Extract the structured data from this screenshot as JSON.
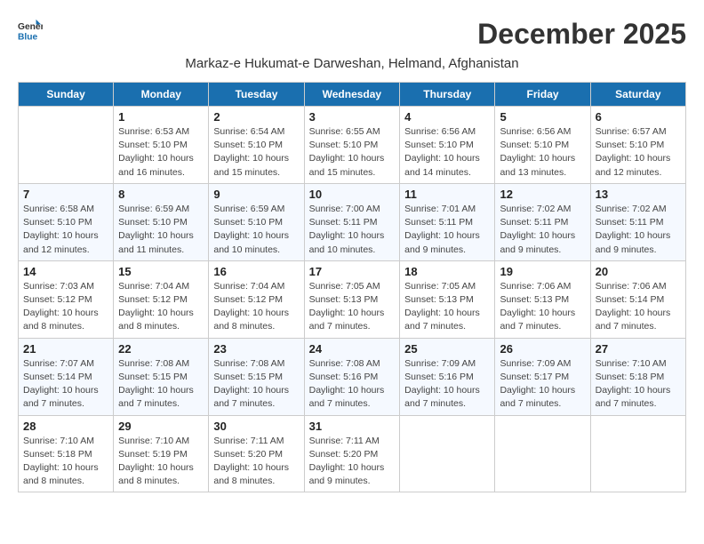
{
  "logo": {
    "line1": "General",
    "line2": "Blue"
  },
  "title": "December 2025",
  "subtitle": "Markaz-e Hukumat-e Darweshan, Helmand, Afghanistan",
  "weekdays": [
    "Sunday",
    "Monday",
    "Tuesday",
    "Wednesday",
    "Thursday",
    "Friday",
    "Saturday"
  ],
  "weeks": [
    [
      {
        "day": "",
        "info": ""
      },
      {
        "day": "1",
        "info": "Sunrise: 6:53 AM\nSunset: 5:10 PM\nDaylight: 10 hours\nand 16 minutes."
      },
      {
        "day": "2",
        "info": "Sunrise: 6:54 AM\nSunset: 5:10 PM\nDaylight: 10 hours\nand 15 minutes."
      },
      {
        "day": "3",
        "info": "Sunrise: 6:55 AM\nSunset: 5:10 PM\nDaylight: 10 hours\nand 15 minutes."
      },
      {
        "day": "4",
        "info": "Sunrise: 6:56 AM\nSunset: 5:10 PM\nDaylight: 10 hours\nand 14 minutes."
      },
      {
        "day": "5",
        "info": "Sunrise: 6:56 AM\nSunset: 5:10 PM\nDaylight: 10 hours\nand 13 minutes."
      },
      {
        "day": "6",
        "info": "Sunrise: 6:57 AM\nSunset: 5:10 PM\nDaylight: 10 hours\nand 12 minutes."
      }
    ],
    [
      {
        "day": "7",
        "info": "Sunrise: 6:58 AM\nSunset: 5:10 PM\nDaylight: 10 hours\nand 12 minutes."
      },
      {
        "day": "8",
        "info": "Sunrise: 6:59 AM\nSunset: 5:10 PM\nDaylight: 10 hours\nand 11 minutes."
      },
      {
        "day": "9",
        "info": "Sunrise: 6:59 AM\nSunset: 5:10 PM\nDaylight: 10 hours\nand 10 minutes."
      },
      {
        "day": "10",
        "info": "Sunrise: 7:00 AM\nSunset: 5:11 PM\nDaylight: 10 hours\nand 10 minutes."
      },
      {
        "day": "11",
        "info": "Sunrise: 7:01 AM\nSunset: 5:11 PM\nDaylight: 10 hours\nand 9 minutes."
      },
      {
        "day": "12",
        "info": "Sunrise: 7:02 AM\nSunset: 5:11 PM\nDaylight: 10 hours\nand 9 minutes."
      },
      {
        "day": "13",
        "info": "Sunrise: 7:02 AM\nSunset: 5:11 PM\nDaylight: 10 hours\nand 9 minutes."
      }
    ],
    [
      {
        "day": "14",
        "info": "Sunrise: 7:03 AM\nSunset: 5:12 PM\nDaylight: 10 hours\nand 8 minutes."
      },
      {
        "day": "15",
        "info": "Sunrise: 7:04 AM\nSunset: 5:12 PM\nDaylight: 10 hours\nand 8 minutes."
      },
      {
        "day": "16",
        "info": "Sunrise: 7:04 AM\nSunset: 5:12 PM\nDaylight: 10 hours\nand 8 minutes."
      },
      {
        "day": "17",
        "info": "Sunrise: 7:05 AM\nSunset: 5:13 PM\nDaylight: 10 hours\nand 7 minutes."
      },
      {
        "day": "18",
        "info": "Sunrise: 7:05 AM\nSunset: 5:13 PM\nDaylight: 10 hours\nand 7 minutes."
      },
      {
        "day": "19",
        "info": "Sunrise: 7:06 AM\nSunset: 5:13 PM\nDaylight: 10 hours\nand 7 minutes."
      },
      {
        "day": "20",
        "info": "Sunrise: 7:06 AM\nSunset: 5:14 PM\nDaylight: 10 hours\nand 7 minutes."
      }
    ],
    [
      {
        "day": "21",
        "info": "Sunrise: 7:07 AM\nSunset: 5:14 PM\nDaylight: 10 hours\nand 7 minutes."
      },
      {
        "day": "22",
        "info": "Sunrise: 7:08 AM\nSunset: 5:15 PM\nDaylight: 10 hours\nand 7 minutes."
      },
      {
        "day": "23",
        "info": "Sunrise: 7:08 AM\nSunset: 5:15 PM\nDaylight: 10 hours\nand 7 minutes."
      },
      {
        "day": "24",
        "info": "Sunrise: 7:08 AM\nSunset: 5:16 PM\nDaylight: 10 hours\nand 7 minutes."
      },
      {
        "day": "25",
        "info": "Sunrise: 7:09 AM\nSunset: 5:16 PM\nDaylight: 10 hours\nand 7 minutes."
      },
      {
        "day": "26",
        "info": "Sunrise: 7:09 AM\nSunset: 5:17 PM\nDaylight: 10 hours\nand 7 minutes."
      },
      {
        "day": "27",
        "info": "Sunrise: 7:10 AM\nSunset: 5:18 PM\nDaylight: 10 hours\nand 7 minutes."
      }
    ],
    [
      {
        "day": "28",
        "info": "Sunrise: 7:10 AM\nSunset: 5:18 PM\nDaylight: 10 hours\nand 8 minutes."
      },
      {
        "day": "29",
        "info": "Sunrise: 7:10 AM\nSunset: 5:19 PM\nDaylight: 10 hours\nand 8 minutes."
      },
      {
        "day": "30",
        "info": "Sunrise: 7:11 AM\nSunset: 5:20 PM\nDaylight: 10 hours\nand 8 minutes."
      },
      {
        "day": "31",
        "info": "Sunrise: 7:11 AM\nSunset: 5:20 PM\nDaylight: 10 hours\nand 9 minutes."
      },
      {
        "day": "",
        "info": ""
      },
      {
        "day": "",
        "info": ""
      },
      {
        "day": "",
        "info": ""
      }
    ]
  ]
}
